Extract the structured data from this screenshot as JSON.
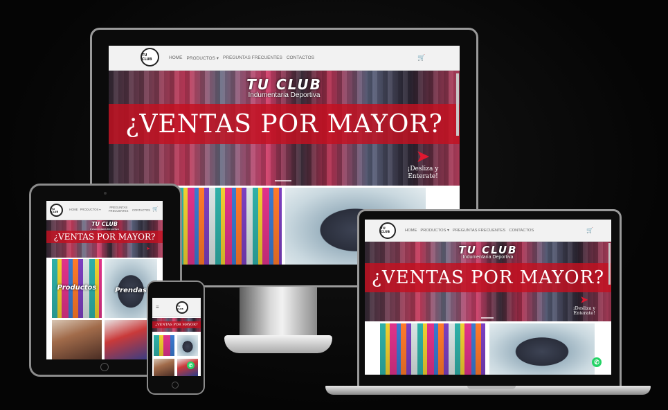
{
  "brand": {
    "logo_text": "TU CLUB",
    "name": "TU CLUB",
    "tagline": "Indumentaria Deportiva"
  },
  "nav": {
    "home": "HOME",
    "products": "PRODUCTOS ▾",
    "faq": "PREGUNTAS FRECUENTES",
    "faq_line1": "PREGUNTAS",
    "faq_line2": "FRECUENTES",
    "contact": "CONTACTOS",
    "cart_icon": "🛒",
    "menu_icon": "≡"
  },
  "hero": {
    "title": "¿VENTAS POR MAYOR?",
    "scroll_hint_line1": "¡Desliza y",
    "scroll_hint_line2": "Enterate!",
    "arrow": "➤"
  },
  "tiles": {
    "products": "Productos",
    "garments": "Prendas"
  },
  "whatsapp_icon": "✆",
  "colors": {
    "accent_red": "#c41020",
    "whatsapp_green": "#25d366",
    "nav_bg": "#f2f2f2"
  }
}
